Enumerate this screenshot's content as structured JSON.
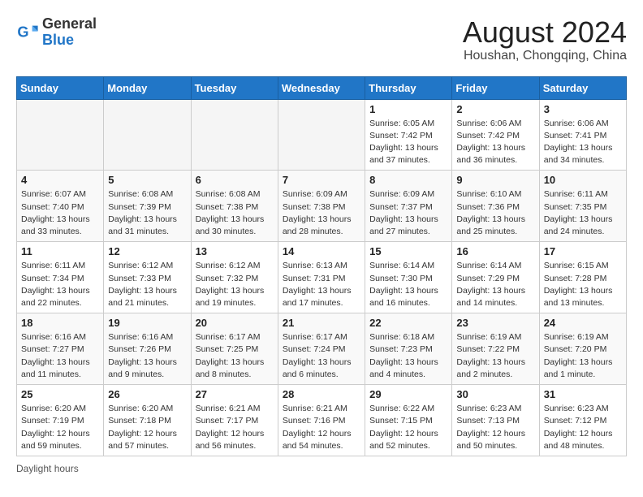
{
  "header": {
    "logo_general": "General",
    "logo_blue": "Blue",
    "title": "August 2024",
    "subtitle": "Houshan, Chongqing, China"
  },
  "weekdays": [
    "Sunday",
    "Monday",
    "Tuesday",
    "Wednesday",
    "Thursday",
    "Friday",
    "Saturday"
  ],
  "weeks": [
    [
      {
        "day": "",
        "info": ""
      },
      {
        "day": "",
        "info": ""
      },
      {
        "day": "",
        "info": ""
      },
      {
        "day": "",
        "info": ""
      },
      {
        "day": "1",
        "info": "Sunrise: 6:05 AM\nSunset: 7:42 PM\nDaylight: 13 hours and 37 minutes."
      },
      {
        "day": "2",
        "info": "Sunrise: 6:06 AM\nSunset: 7:42 PM\nDaylight: 13 hours and 36 minutes."
      },
      {
        "day": "3",
        "info": "Sunrise: 6:06 AM\nSunset: 7:41 PM\nDaylight: 13 hours and 34 minutes."
      }
    ],
    [
      {
        "day": "4",
        "info": "Sunrise: 6:07 AM\nSunset: 7:40 PM\nDaylight: 13 hours and 33 minutes."
      },
      {
        "day": "5",
        "info": "Sunrise: 6:08 AM\nSunset: 7:39 PM\nDaylight: 13 hours and 31 minutes."
      },
      {
        "day": "6",
        "info": "Sunrise: 6:08 AM\nSunset: 7:38 PM\nDaylight: 13 hours and 30 minutes."
      },
      {
        "day": "7",
        "info": "Sunrise: 6:09 AM\nSunset: 7:38 PM\nDaylight: 13 hours and 28 minutes."
      },
      {
        "day": "8",
        "info": "Sunrise: 6:09 AM\nSunset: 7:37 PM\nDaylight: 13 hours and 27 minutes."
      },
      {
        "day": "9",
        "info": "Sunrise: 6:10 AM\nSunset: 7:36 PM\nDaylight: 13 hours and 25 minutes."
      },
      {
        "day": "10",
        "info": "Sunrise: 6:11 AM\nSunset: 7:35 PM\nDaylight: 13 hours and 24 minutes."
      }
    ],
    [
      {
        "day": "11",
        "info": "Sunrise: 6:11 AM\nSunset: 7:34 PM\nDaylight: 13 hours and 22 minutes."
      },
      {
        "day": "12",
        "info": "Sunrise: 6:12 AM\nSunset: 7:33 PM\nDaylight: 13 hours and 21 minutes."
      },
      {
        "day": "13",
        "info": "Sunrise: 6:12 AM\nSunset: 7:32 PM\nDaylight: 13 hours and 19 minutes."
      },
      {
        "day": "14",
        "info": "Sunrise: 6:13 AM\nSunset: 7:31 PM\nDaylight: 13 hours and 17 minutes."
      },
      {
        "day": "15",
        "info": "Sunrise: 6:14 AM\nSunset: 7:30 PM\nDaylight: 13 hours and 16 minutes."
      },
      {
        "day": "16",
        "info": "Sunrise: 6:14 AM\nSunset: 7:29 PM\nDaylight: 13 hours and 14 minutes."
      },
      {
        "day": "17",
        "info": "Sunrise: 6:15 AM\nSunset: 7:28 PM\nDaylight: 13 hours and 13 minutes."
      }
    ],
    [
      {
        "day": "18",
        "info": "Sunrise: 6:16 AM\nSunset: 7:27 PM\nDaylight: 13 hours and 11 minutes."
      },
      {
        "day": "19",
        "info": "Sunrise: 6:16 AM\nSunset: 7:26 PM\nDaylight: 13 hours and 9 minutes."
      },
      {
        "day": "20",
        "info": "Sunrise: 6:17 AM\nSunset: 7:25 PM\nDaylight: 13 hours and 8 minutes."
      },
      {
        "day": "21",
        "info": "Sunrise: 6:17 AM\nSunset: 7:24 PM\nDaylight: 13 hours and 6 minutes."
      },
      {
        "day": "22",
        "info": "Sunrise: 6:18 AM\nSunset: 7:23 PM\nDaylight: 13 hours and 4 minutes."
      },
      {
        "day": "23",
        "info": "Sunrise: 6:19 AM\nSunset: 7:22 PM\nDaylight: 13 hours and 2 minutes."
      },
      {
        "day": "24",
        "info": "Sunrise: 6:19 AM\nSunset: 7:20 PM\nDaylight: 13 hours and 1 minute."
      }
    ],
    [
      {
        "day": "25",
        "info": "Sunrise: 6:20 AM\nSunset: 7:19 PM\nDaylight: 12 hours and 59 minutes."
      },
      {
        "day": "26",
        "info": "Sunrise: 6:20 AM\nSunset: 7:18 PM\nDaylight: 12 hours and 57 minutes."
      },
      {
        "day": "27",
        "info": "Sunrise: 6:21 AM\nSunset: 7:17 PM\nDaylight: 12 hours and 56 minutes."
      },
      {
        "day": "28",
        "info": "Sunrise: 6:21 AM\nSunset: 7:16 PM\nDaylight: 12 hours and 54 minutes."
      },
      {
        "day": "29",
        "info": "Sunrise: 6:22 AM\nSunset: 7:15 PM\nDaylight: 12 hours and 52 minutes."
      },
      {
        "day": "30",
        "info": "Sunrise: 6:23 AM\nSunset: 7:13 PM\nDaylight: 12 hours and 50 minutes."
      },
      {
        "day": "31",
        "info": "Sunrise: 6:23 AM\nSunset: 7:12 PM\nDaylight: 12 hours and 48 minutes."
      }
    ]
  ],
  "footer": {
    "daylight_label": "Daylight hours"
  }
}
